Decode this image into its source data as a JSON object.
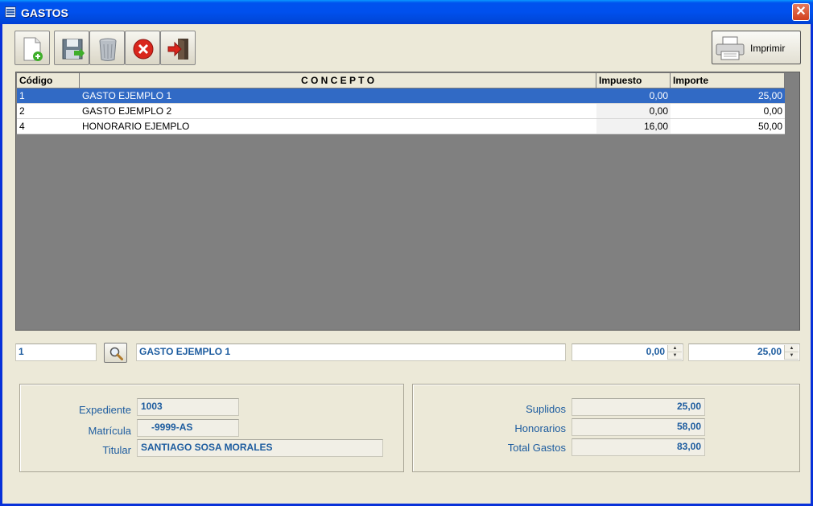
{
  "window": {
    "title": "GASTOS",
    "close_glyph": "✕"
  },
  "toolbar": {
    "buttons": [
      {
        "name": "new-record-button",
        "icon": "new-document-icon"
      },
      {
        "name": "save-button",
        "icon": "save-icon"
      },
      {
        "name": "delete-button",
        "icon": "trash-icon"
      },
      {
        "name": "cancel-button",
        "icon": "cancel-icon"
      },
      {
        "name": "exit-button",
        "icon": "exit-icon"
      }
    ],
    "print_label": "Imprimir"
  },
  "grid": {
    "columns": [
      "Código",
      "C O N C E P T O",
      "Impuesto",
      "Importe"
    ],
    "rows": [
      {
        "codigo": "1",
        "concepto": "GASTO EJEMPLO 1",
        "impuesto": "0,00",
        "importe": "25,00",
        "selected": true
      },
      {
        "codigo": "2",
        "concepto": "GASTO EJEMPLO 2",
        "impuesto": "0,00",
        "importe": "0,00",
        "selected": false
      },
      {
        "codigo": "4",
        "concepto": "HONORARIO EJEMPLO",
        "impuesto": "16,00",
        "importe": "50,00",
        "selected": false
      }
    ]
  },
  "edit": {
    "codigo": "1",
    "concepto": "GASTO EJEMPLO 1",
    "impuesto": "0,00",
    "importe": "25,00"
  },
  "left_panel": {
    "expediente_label": "Expediente",
    "expediente": "1003",
    "matricula_label": "Matrícula",
    "matricula": "-9999-AS",
    "titular_label": "Titular",
    "titular": "SANTIAGO SOSA MORALES"
  },
  "right_panel": {
    "suplidos_label": "Suplidos",
    "suplidos": "25,00",
    "honorarios_label": "Honorarios",
    "honorarios": "58,00",
    "total_label": "Total Gastos",
    "total": "83,00"
  },
  "colors": {
    "selection": "#316ac5",
    "field_text": "#1d5c9f",
    "grid_background": "#808080"
  }
}
